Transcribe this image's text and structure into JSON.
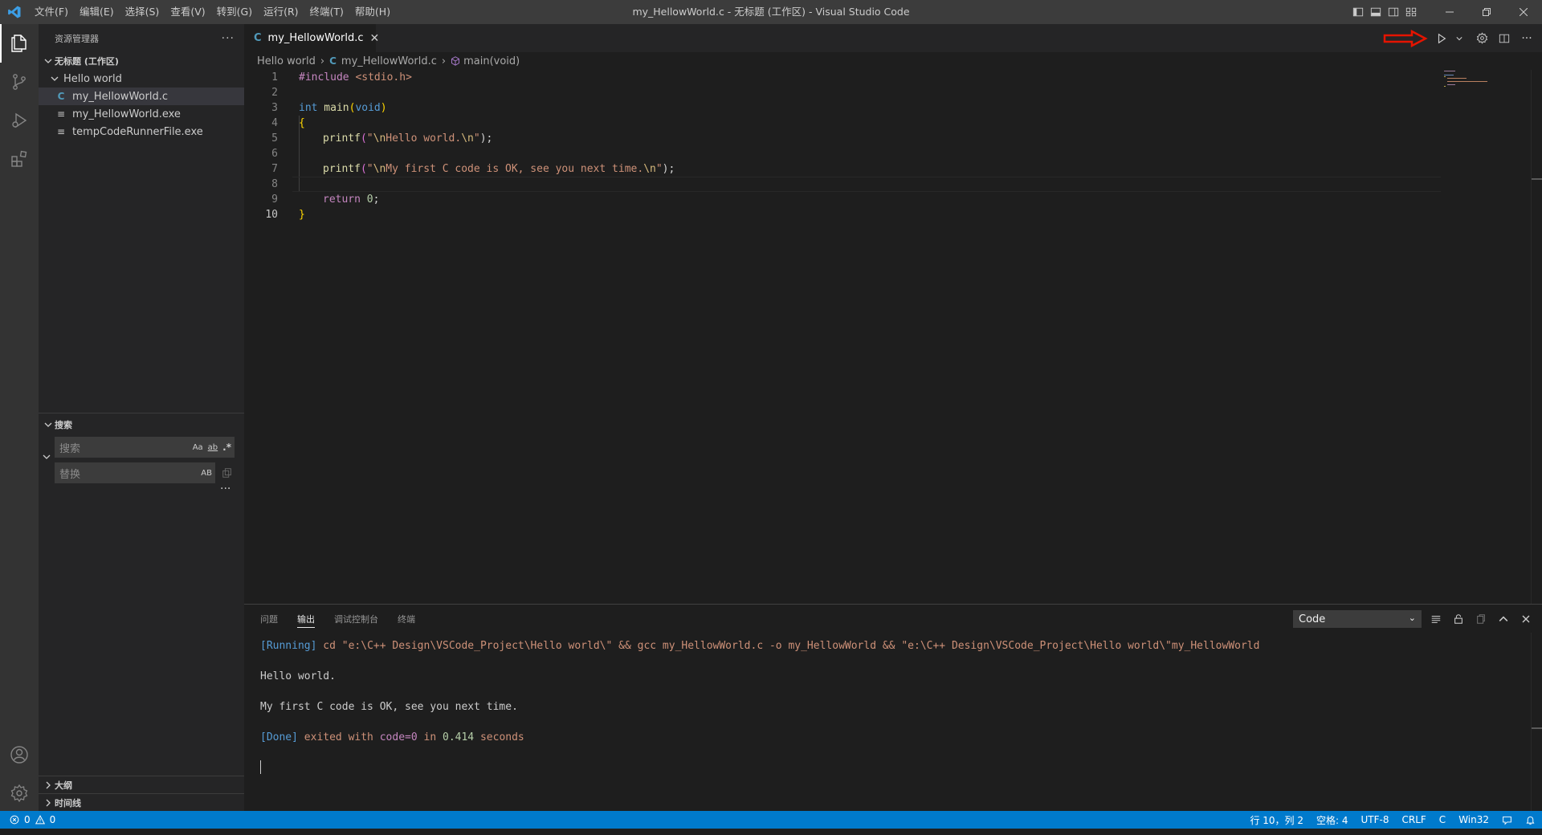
{
  "window": {
    "title": "my_HellowWorld.c - 无标题 (工作区) - Visual Studio Code"
  },
  "menu": [
    "文件(F)",
    "编辑(E)",
    "选择(S)",
    "查看(V)",
    "转到(G)",
    "运行(R)",
    "终端(T)",
    "帮助(H)"
  ],
  "sidebar": {
    "title": "资源管理器",
    "workspace_label": "无标题 (工作区)",
    "folder": "Hello world",
    "files": [
      {
        "name": "my_HellowWorld.c",
        "icon": "C"
      },
      {
        "name": "my_HellowWorld.exe",
        "icon": "≡"
      },
      {
        "name": "tempCodeRunnerFile.exe",
        "icon": "≡"
      }
    ],
    "search": {
      "title": "搜索",
      "search_placeholder": "搜索",
      "replace_placeholder": "替换",
      "opt_case": "Aa",
      "opt_word": "ab",
      "opt_regex": ".*",
      "opt_preserve": "AB"
    },
    "outline": "大纲",
    "timeline": "时间线"
  },
  "editor": {
    "tab_icon": "C",
    "tab_label": "my_HellowWorld.c",
    "breadcrumb": {
      "folder": "Hello world",
      "file": "my_HellowWorld.c",
      "symbol": "main(void)"
    },
    "lines": [
      "1",
      "2",
      "3",
      "4",
      "5",
      "6",
      "7",
      "8",
      "9",
      "10"
    ],
    "code": {
      "l1_kw": "#include",
      "l1_hdr": " <stdio.h>",
      "l3_type": "int",
      "l3_fn": " main",
      "l3_p1": "(",
      "l3_void": "void",
      "l3_p2": ")",
      "l4": "{",
      "l5_fn": "printf",
      "l5_p1": "(",
      "l5_esc1": "\\n",
      "l5_str": "Hello world.",
      "l5_esc2": "\\n",
      "l5_q": "\"",
      "l5_end": ");",
      "l7_fn": "printf",
      "l7_p1": "(",
      "l7_esc1": "\\n",
      "l7_str": "My first C code is OK, see you next time.",
      "l7_esc2": "\\n",
      "l7_q": "\"",
      "l7_end": ");",
      "l9_kw": "return",
      "l9_num": " 0",
      "l9_end": ";",
      "l10": "}"
    }
  },
  "panel": {
    "tabs": [
      "问题",
      "输出",
      "调试控制台",
      "终端"
    ],
    "active_tab": "输出",
    "channel": "Code",
    "output": {
      "running_tag": "[Running]",
      "running_cmd": " cd \"e:\\C++ Design\\VSCode_Project\\Hello world\\\" && gcc my_HellowWorld.c -o my_HellowWorld && \"e:\\C++ Design\\VSCode_Project\\Hello world\\\"my_HellowWorld",
      "line1": "Hello world.",
      "line2": "My first C code is OK, see you next time.",
      "done_tag": "[Done]",
      "done_a": " exited with ",
      "done_code": "code=0",
      "done_b": " in ",
      "done_time": "0.414",
      "done_c": " seconds"
    }
  },
  "status": {
    "errors": "0",
    "warnings": "0",
    "position": "行 10，列 2",
    "spaces": "空格: 4",
    "encoding": "UTF-8",
    "eol": "CRLF",
    "language": "C",
    "platform": "Win32"
  },
  "colors": {
    "accent": "#007acc",
    "keyword": "#569cd6",
    "control": "#c586c0",
    "function": "#dcdcaa",
    "string": "#ce9178",
    "escape": "#d7ba7d",
    "number": "#b5cea8",
    "arrow": "#e51400"
  }
}
